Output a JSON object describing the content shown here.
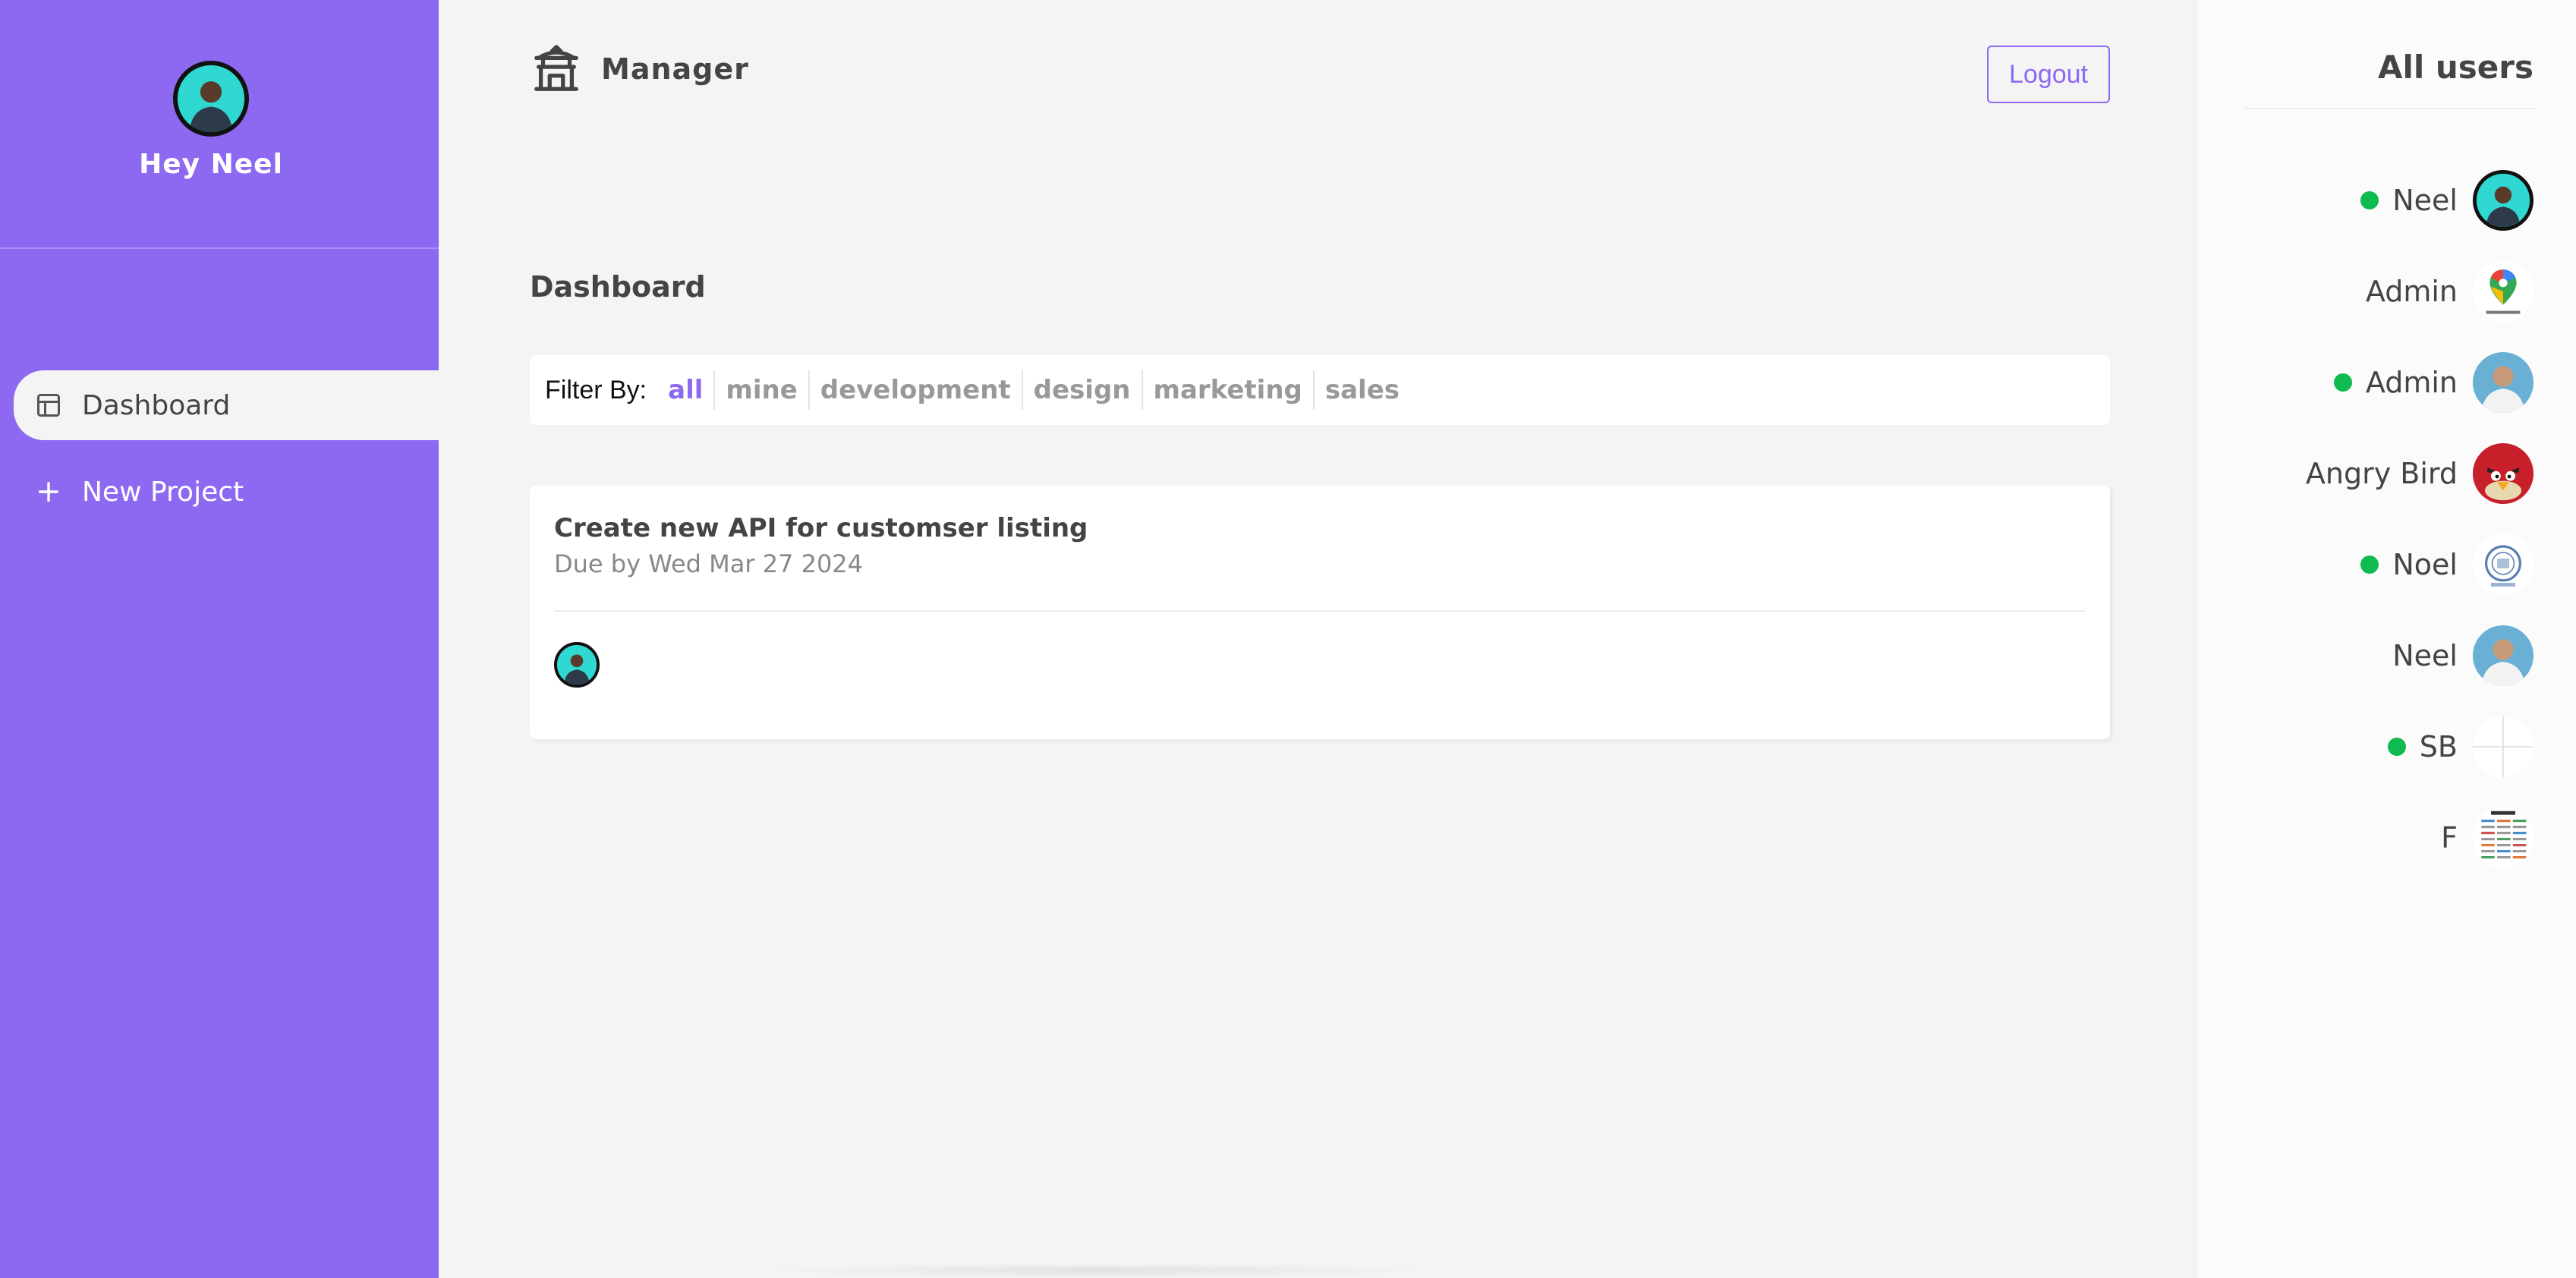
{
  "sidebar": {
    "greeting": "Hey Neel",
    "nav": [
      {
        "label": "Dashboard",
        "icon": "layout-icon",
        "active": true
      },
      {
        "label": "New Project",
        "icon": "plus-icon",
        "active": false
      }
    ]
  },
  "header": {
    "brand": "Manager",
    "brand_icon": "temple-icon",
    "logout_label": "Logout"
  },
  "main": {
    "title": "Dashboard",
    "filter": {
      "label": "Filter By:",
      "options": [
        "all",
        "mine",
        "development",
        "design",
        "marketing",
        "sales"
      ],
      "active": "all"
    },
    "projects": [
      {
        "name": "Create new API for customser listing",
        "due": "Due by Wed Mar 27 2024"
      }
    ]
  },
  "users_panel": {
    "title": "All users",
    "users": [
      {
        "name": "Neel",
        "online": true,
        "avatar": "person-teal-icon"
      },
      {
        "name": "Admin",
        "online": false,
        "avatar": "maps-pin-icon"
      },
      {
        "name": "Admin",
        "online": true,
        "avatar": "person-photo-icon"
      },
      {
        "name": "Angry Bird",
        "online": false,
        "avatar": "angry-bird-icon"
      },
      {
        "name": "Noel",
        "online": true,
        "avatar": "emblem-icon"
      },
      {
        "name": "Neel",
        "online": false,
        "avatar": "person-photo-icon"
      },
      {
        "name": "SB",
        "online": true,
        "avatar": "crosshair-icon"
      },
      {
        "name": "F",
        "online": false,
        "avatar": "cheatsheet-icon"
      }
    ]
  },
  "colors": {
    "primary": "#8d69f1",
    "background": "#f4f4f4",
    "online": "#0ebb50",
    "text": "#444444"
  }
}
